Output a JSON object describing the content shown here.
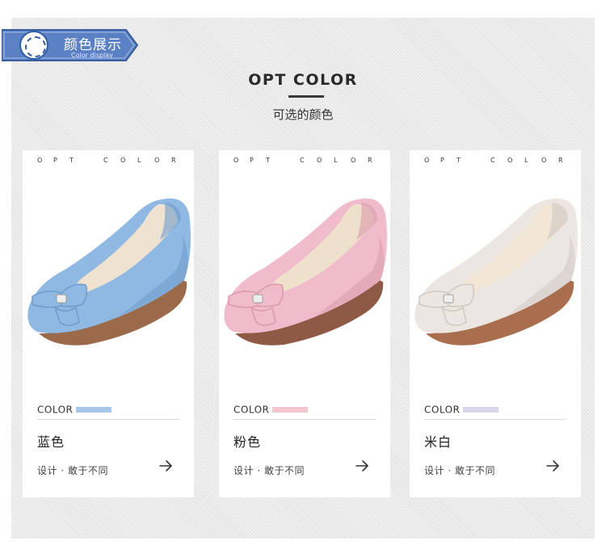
{
  "header": {
    "badge_title": "颜色展示",
    "badge_subtitle": "Color display",
    "badge_color": "#5b80c4"
  },
  "section": {
    "title": "OPT COLOR",
    "subtitle": "可选的颜色"
  },
  "cards": [
    {
      "opt_letters": [
        "O",
        "P",
        "T",
        "C",
        "O",
        "L",
        "O",
        "R"
      ],
      "color_label": "COLOR",
      "swatch_color": "#a6c6ea",
      "name": "蓝色",
      "tagline": "设计 · 敢于不同",
      "arrow_icon": "arrow-right-icon",
      "shoe_colors": {
        "upper": "#8fb8e2",
        "shade": "#6f9bcc",
        "lining": "#efe2d0",
        "sole": "#9a6a4b"
      }
    },
    {
      "opt_letters": [
        "O",
        "P",
        "T",
        "C",
        "O",
        "L",
        "O",
        "R"
      ],
      "color_label": "COLOR",
      "swatch_color": "#f4c5ce",
      "name": "粉色",
      "tagline": "设计 · 敢于不同",
      "arrow_icon": "arrow-right-icon",
      "shoe_colors": {
        "upper": "#f0bccb",
        "shade": "#d99aac",
        "lining": "#efe0cc",
        "sole": "#8f5a45"
      }
    },
    {
      "opt_letters": [
        "O",
        "P",
        "T",
        "C",
        "O",
        "L",
        "O",
        "R"
      ],
      "color_label": "COLOR",
      "swatch_color": "#d8d6ea",
      "name": "米白",
      "tagline": "设计 · 敢于不同",
      "arrow_icon": "arrow-right-icon",
      "shoe_colors": {
        "upper": "#ece6e2",
        "shade": "#cfc7c2",
        "lining": "#f2e7d7",
        "sole": "#a86e4d"
      }
    }
  ]
}
